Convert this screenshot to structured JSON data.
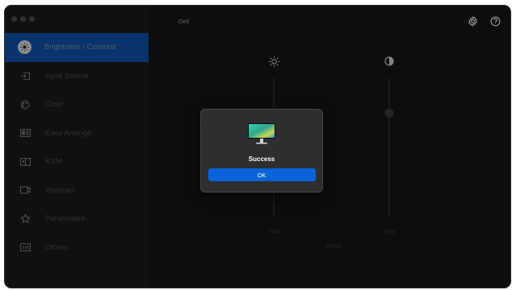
{
  "window": {
    "title": "Dell"
  },
  "sidebar": {
    "items": [
      {
        "label": "Brightness / Contrast",
        "icon": "brightness-icon",
        "active": true
      },
      {
        "label": "Input Source",
        "icon": "input-source-icon"
      },
      {
        "label": "Color",
        "icon": "color-icon"
      },
      {
        "label": "Easy Arrange",
        "icon": "easy-arrange-icon"
      },
      {
        "label": "KVM",
        "icon": "kvm-icon"
      },
      {
        "label": "Webcam",
        "icon": "webcam-icon"
      },
      {
        "label": "Personalize",
        "icon": "star-icon"
      },
      {
        "label": "Others",
        "icon": "others-icon"
      }
    ]
  },
  "toolbar": {
    "settings_icon": "gear-icon",
    "help_icon": "help-icon"
  },
  "main": {
    "brightness": {
      "value_label": "75%",
      "level": 0.75
    },
    "contrast": {
      "value_label": "75%",
      "level": 0.75
    },
    "reset_label": "Reset"
  },
  "dialog": {
    "message": "Success",
    "ok_label": "OK"
  },
  "colors": {
    "accent": "#0a63d8",
    "active_item": "#0f4fa3",
    "background": "#141416"
  }
}
